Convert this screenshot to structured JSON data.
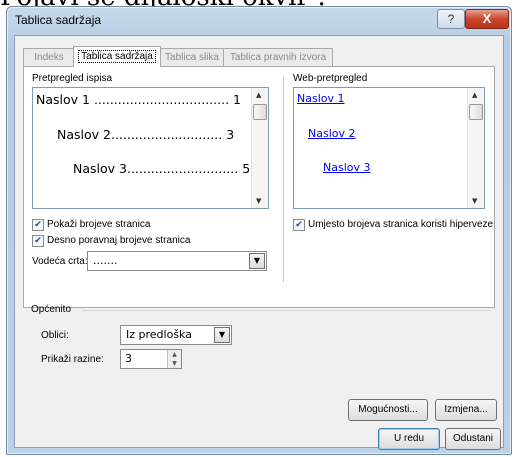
{
  "background_caption": "Pojavi se dijaloški okvir :",
  "window": {
    "title": "Tablica sadržaja",
    "help_label": "?",
    "close_label": "X"
  },
  "tabs": [
    {
      "label": "Indeks",
      "active": false
    },
    {
      "label": "Tablica sadržaja",
      "active": true
    },
    {
      "label": "Tablica slika",
      "active": false
    },
    {
      "label": "Tablica pravnih izvora",
      "active": false
    }
  ],
  "print_preview": {
    "label": "Pretpregled ispisa",
    "lines": [
      {
        "text": "Naslov 1 .................................. 1"
      },
      {
        "text": "Naslov 2............................ 3"
      },
      {
        "text": "Naslov 3............................ 5"
      }
    ]
  },
  "web_preview": {
    "label": "Web-pretpregled",
    "links": [
      "Naslov 1",
      "Naslov 2",
      "Naslov 3"
    ]
  },
  "options": {
    "show_page_numbers": {
      "label": "Pokaži brojeve stranica",
      "checked": true
    },
    "right_align_page_numbers": {
      "label": "Desno poravnaj brojeve stranica",
      "checked": true
    },
    "use_hyperlinks": {
      "label": "Umjesto brojeva stranica koristi hiperveze",
      "checked": true
    },
    "tab_leader_label": "Vodeća crta:",
    "tab_leader_value": "......."
  },
  "general": {
    "group_label": "Općenito",
    "formats_label": "Oblici:",
    "formats_value": "Iz predloška",
    "show_levels_label": "Prikaži razine:",
    "show_levels_value": "3"
  },
  "buttons": {
    "options": "Mogućnosti...",
    "modify": "Izmjena...",
    "ok": "U redu",
    "cancel": "Odustani"
  },
  "colors": {
    "link": "#0000ee",
    "title_bar": "#b5cbe3",
    "close_button": "#c8452c"
  }
}
